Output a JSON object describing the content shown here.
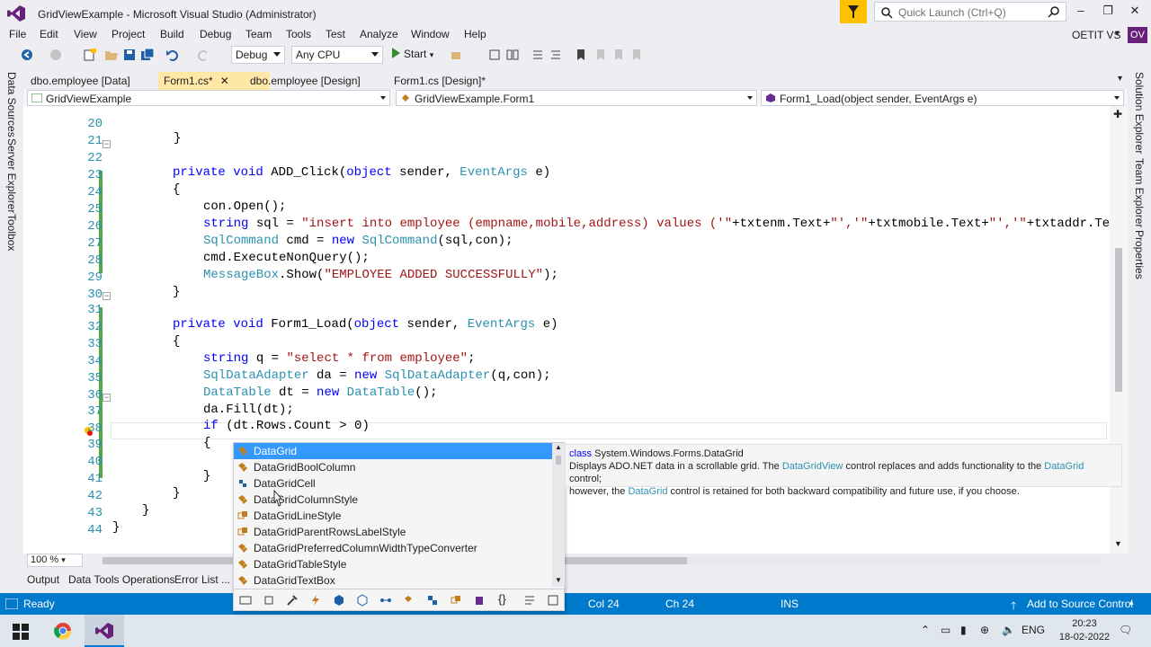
{
  "window": {
    "title": "GridViewExample - Microsoft Visual Studio  (Administrator)",
    "quick_launch_placeholder": "Quick Launch (Ctrl+Q)",
    "user": "OETIT VS",
    "user_initials": "OV"
  },
  "menu": [
    "File",
    "Edit",
    "View",
    "Project",
    "Build",
    "Debug",
    "Team",
    "Tools",
    "Test",
    "Analyze",
    "Window",
    "Help"
  ],
  "toolbar": {
    "config": "Debug",
    "platform": "Any CPU",
    "start_label": "Start"
  },
  "side_tabs": {
    "left": [
      "Data Sources",
      "Server Explorer",
      "Toolbox"
    ],
    "right": [
      "Solution Explorer",
      "Team Explorer",
      "Properties"
    ]
  },
  "doc_tabs": [
    "dbo.employee [Data]",
    "Form1.cs*",
    "dbo.employee [Design]",
    "Form1.cs [Design]*"
  ],
  "nav": {
    "project": "GridViewExample",
    "class": "GridViewExample.Form1",
    "member": "Form1_Load(object sender, EventArgs e)"
  },
  "code": {
    "line_numbers": [
      "20",
      "21",
      "22",
      "23",
      "24",
      "25",
      "26",
      "27",
      "28",
      "29",
      "30",
      "31",
      "32",
      "33",
      "34",
      "35",
      "36",
      "37",
      "38",
      "39",
      "40",
      "41",
      "42",
      "43",
      "44"
    ],
    "l20": "}",
    "l22_kw": "private void",
    "l22_rest": " ADD_Click(",
    "l22_kw2": "object",
    "l22_rest2": " sender, ",
    "l22_ty": "EventArgs",
    "l22_rest3": " e)",
    "l23": "{",
    "l24": "con.Open();",
    "l25_kw": "string",
    "l25_rest": " sql = ",
    "l25_str": "\"insert into employee (empname,mobile,address) values ('\"",
    "l25_rest2": "+txtenm.Text+",
    "l25_str2": "\"','\"",
    "l25_rest3": "+txtmobile.Text+",
    "l25_str3": "\"','\"",
    "l25_rest4": "+txtaddr.Te",
    "l26_ty": "SqlCommand",
    "l26_rest": " cmd = ",
    "l26_kw": "new",
    "l26_ty2": "SqlCommand",
    "l26_rest2": "(sql,con);",
    "l27": "cmd.ExecuteNonQuery();",
    "l28_ty": "MessageBox",
    "l28_rest": ".Show(",
    "l28_str": "\"EMPLOYEE ADDED SUCCESSFULLY\"",
    "l28_rest2": ");",
    "l29": "}",
    "l31_kw": "private void",
    "l31_rest": " Form1_Load(",
    "l31_kw2": "object",
    "l31_rest2": " sender, ",
    "l31_ty": "EventArgs",
    "l31_rest3": " e)",
    "l32": "{",
    "l33_kw": "string",
    "l33_rest": " q = ",
    "l33_str": "\"select * from employee\"",
    "l33_rest2": ";",
    "l34_ty": "SqlDataAdapter",
    "l34_rest": " da = ",
    "l34_kw": "new",
    "l34_ty2": "SqlDataAdapter",
    "l34_rest2": "(q,con);",
    "l35_ty": "DataTable",
    "l35_rest": " dt = ",
    "l35_kw": "new",
    "l35_ty2": "DataTable",
    "l35_rest2": "();",
    "l36": "da.Fill(dt);",
    "l37_kw": "if",
    "l37_rest": " (dt.Rows.Count > 0)",
    "l38": "{",
    "l39": "datagri",
    "l40": "}",
    "l41": "}",
    "l42": "}",
    "l43": "}"
  },
  "intellisense": {
    "items": [
      "DataGrid",
      "DataGridBoolColumn",
      "DataGridCell",
      "DataGridColumnStyle",
      "DataGridLineStyle",
      "DataGridParentRowsLabelStyle",
      "DataGridPreferredColumnWidthTypeConverter",
      "DataGridTableStyle",
      "DataGridTextBox"
    ],
    "tooltip_kw": "class",
    "tooltip_name": " System.Windows.Forms.DataGrid",
    "tooltip_p1": "Displays ADO.NET data in a scrollable grid. The ",
    "tooltip_link1": "DataGridView",
    "tooltip_p2": " control replaces and adds functionality to the ",
    "tooltip_link2": "DataGrid",
    "tooltip_p3": " control;",
    "tooltip_p4": "however, the ",
    "tooltip_link3": "DataGrid",
    "tooltip_p5": " control is retained for both backward compatibility and future use, if you choose."
  },
  "editor_footer": {
    "zoom": "100 %"
  },
  "tool_tabs": [
    "Output",
    "Data Tools Operations",
    "Error List ..."
  ],
  "status": {
    "state": "Ready",
    "col": "Col 24",
    "ch": "Ch 24",
    "mode": "INS",
    "source_control": "Add to Source Control"
  },
  "taskbar": {
    "lang": "ENG",
    "time": "20:23",
    "date": "18-02-2022"
  },
  "colors": {
    "accent": "#007acc",
    "keyword": "#0000ff",
    "type": "#2b91af",
    "string": "#a31515",
    "selection": "#3399ff",
    "active_tab": "#ffe8a6"
  }
}
